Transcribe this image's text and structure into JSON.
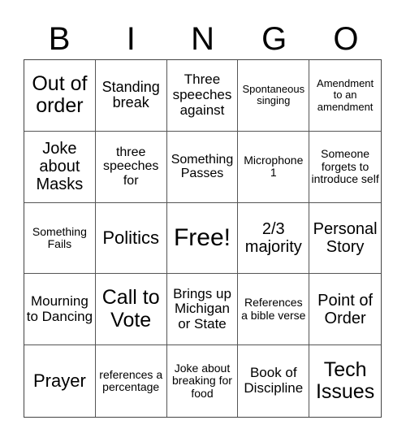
{
  "header": {
    "letters": [
      "B",
      "I",
      "N",
      "G",
      "O"
    ]
  },
  "cells": [
    [
      "Out of order",
      "Standing break",
      "Three speeches against",
      "Spontaneous singing",
      "Amendment to an amendment"
    ],
    [
      "Joke about Masks",
      "three speeches for",
      "Something Passes",
      "Microphone 1",
      "Someone forgets to introduce self"
    ],
    [
      "Something Fails",
      "Politics",
      "Free!",
      "2/3 majority",
      "Personal Story"
    ],
    [
      "Mourning to Dancing",
      "Call to Vote",
      "Brings up Michigan or State",
      "References a bible verse",
      "Point of Order"
    ],
    [
      "Prayer",
      "references a percentage",
      "Joke about breaking for food",
      "Book of Discipline",
      "Tech Issues"
    ]
  ]
}
